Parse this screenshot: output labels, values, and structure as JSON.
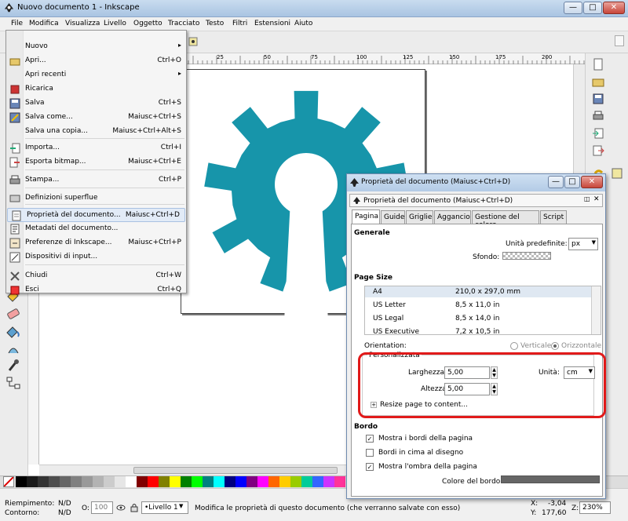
{
  "window": {
    "title": "Nuovo documento 1 - Inkscape",
    "minimize": "—",
    "maximize": "□",
    "close": "✕"
  },
  "menubar": [
    "File",
    "Modifica",
    "Visualizza",
    "Livello",
    "Oggetto",
    "Tracciato",
    "Testo",
    "Filtri",
    "Estensioni",
    "Aiuto"
  ],
  "file_menu": {
    "items": [
      {
        "label": "Nuovo",
        "shortcut": "",
        "arrow": "▸",
        "icon": "none"
      },
      {
        "label": "Apri...",
        "shortcut": "Ctrl+O",
        "arrow": "",
        "icon": "open-folder-icon"
      },
      {
        "label": "Apri recenti",
        "shortcut": "",
        "arrow": "▸",
        "icon": "none"
      },
      {
        "label": "Ricarica",
        "shortcut": "",
        "arrow": "",
        "icon": "revert-icon"
      },
      {
        "label": "Salva",
        "shortcut": "Ctrl+S",
        "arrow": "",
        "icon": "save-icon"
      },
      {
        "label": "Salva come...",
        "shortcut": "Maiusc+Ctrl+S",
        "arrow": "",
        "icon": "save-as-icon"
      },
      {
        "label": "Salva una copia...",
        "shortcut": "Maiusc+Ctrl+Alt+S",
        "arrow": "",
        "icon": "none"
      },
      {
        "label": "Importa...",
        "shortcut": "Ctrl+I",
        "arrow": "",
        "icon": "import-icon"
      },
      {
        "label": "Esporta bitmap...",
        "shortcut": "Maiusc+Ctrl+E",
        "arrow": "",
        "icon": "export-icon"
      },
      {
        "label": "Stampa...",
        "shortcut": "Ctrl+P",
        "arrow": "",
        "icon": "print-icon"
      },
      {
        "label": "Definizioni superflue",
        "shortcut": "",
        "arrow": "",
        "icon": "vacuum-icon"
      },
      {
        "label": "Proprietà del documento...",
        "shortcut": "Maiusc+Ctrl+D",
        "arrow": "",
        "icon": "document-properties-icon"
      },
      {
        "label": "Metadati del documento...",
        "shortcut": "",
        "arrow": "",
        "icon": "metadata-icon"
      },
      {
        "label": "Preferenze di Inkscape...",
        "shortcut": "Maiusc+Ctrl+P",
        "arrow": "",
        "icon": "preferences-icon"
      },
      {
        "label": "Dispositivi di input...",
        "shortcut": "",
        "arrow": "",
        "icon": "input-devices-icon"
      },
      {
        "label": "Chiudi",
        "shortcut": "Ctrl+W",
        "arrow": "",
        "icon": "close-doc-icon"
      },
      {
        "label": "Esci",
        "shortcut": "Ctrl+Q",
        "arrow": "",
        "icon": "quit-icon"
      }
    ]
  },
  "ruler": [
    "25",
    "50",
    "75",
    "100",
    "125",
    "150",
    "175",
    "200"
  ],
  "dialog": {
    "window_title": "Proprietà del documento (Maiusc+Ctrl+D)",
    "panel_title": "Proprietà del documento (Maiusc+Ctrl+D)",
    "tabs": [
      "Pagina",
      "Guide",
      "Griglie",
      "Aggancio",
      "Gestione del colore",
      "Script"
    ],
    "generale": {
      "heading": "Generale",
      "units_label": "Unità predefinite:",
      "units_value": "px",
      "background_label": "Sfondo:"
    },
    "page_size": {
      "heading": "Page Size",
      "rows": [
        {
          "name": "A4",
          "size": "210,0 x 297,0 mm"
        },
        {
          "name": "US Letter",
          "size": "8,5 x 11,0 in"
        },
        {
          "name": "US Legal",
          "size": "8,5 x 14,0 in"
        },
        {
          "name": "US Executive",
          "size": "7,2 x 10,5 in"
        }
      ],
      "orientation_label": "Orientation:",
      "portrait": "Verticale",
      "landscape": "Orizzontale"
    },
    "custom": {
      "legend": "Personalizzata",
      "width_label": "Larghezza:",
      "width_value": "5,00",
      "height_label": "Altezza:",
      "height_value": "5,00",
      "units_label": "Unità:",
      "units_value": "cm",
      "resize_label": "Resize page to content..."
    },
    "border": {
      "heading": "Bordo",
      "show_border": "Mostra i bordi della pagina",
      "border_on_top": "Bordi in cima al disegno",
      "show_shadow": "Mostra l'ombra della pagina",
      "border_color_label": "Colore del bordo:"
    }
  },
  "status": {
    "fill_label": "Riempimento:",
    "fill_value": "N/D",
    "stroke_label": "Contorno:",
    "stroke_value": "N/D",
    "opacity_label": "O:",
    "opacity_value": "100",
    "layer": "•Livello 1",
    "message": "Modifica le proprietà di questo documento (che verranno salvate con esso)",
    "x_label": "X:",
    "x_value": "-3,04",
    "y_label": "Y:",
    "y_value": "177,60",
    "zoom_label": "Z:",
    "zoom_value": "230%"
  },
  "colors": {
    "logo": "#1795aa",
    "highlight": "#e11a1a",
    "border_swatch": "#666666"
  }
}
